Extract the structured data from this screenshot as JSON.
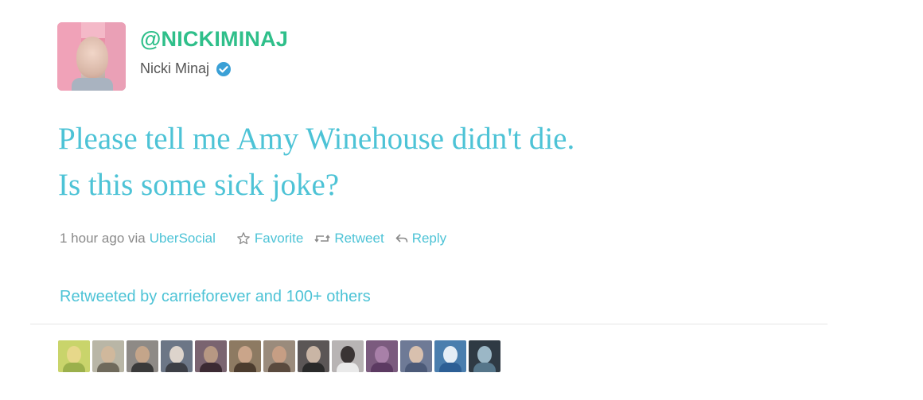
{
  "tweet": {
    "handle": "@NICKIMINAJ",
    "name": "Nicki Minaj",
    "verified": true,
    "text_lines": [
      "Please tell me Amy Winehouse didn't die.",
      "Is this some sick joke?"
    ],
    "time": "1 hour ago via",
    "client": "UberSocial",
    "actions": {
      "favorite": "Favorite",
      "retweet": "Retweet",
      "reply": "Reply"
    }
  },
  "retweets": {
    "label_prefix": "Retweeted by",
    "user": "carrieforever",
    "suffix": "and 100+ others"
  },
  "retweeters": [
    {
      "bg": "#c9d46b",
      "head": "#e7d88a",
      "body": "#9bb04c"
    },
    {
      "bg": "#b9b6a6",
      "head": "#d0b89c",
      "body": "#6f6a5c"
    },
    {
      "bg": "#8e8a86",
      "head": "#c4a58a",
      "body": "#3a3a3a"
    },
    {
      "bg": "#6c7686",
      "head": "#ddd4cc",
      "body": "#3d3f46"
    },
    {
      "bg": "#7a6470",
      "head": "#b79883",
      "body": "#3c2a33"
    },
    {
      "bg": "#8d7a62",
      "head": "#caa58a",
      "body": "#4c3c2e"
    },
    {
      "bg": "#9a8b7c",
      "head": "#c69e84",
      "body": "#5a4a3e"
    },
    {
      "bg": "#5b5656",
      "head": "#c9b5a5",
      "body": "#2a2a2a"
    },
    {
      "bg": "#b8b4b4",
      "head": "#3a3434",
      "body": "#eaeaea"
    },
    {
      "bg": "#7b5b7e",
      "head": "#a880a8",
      "body": "#5c3a62"
    },
    {
      "bg": "#6e7a96",
      "head": "#d8c0ae",
      "body": "#4c5a78"
    },
    {
      "bg": "#4a7eae",
      "head": "#e6eef6",
      "body": "#2d5f95"
    },
    {
      "bg": "#2f3a44",
      "head": "#9bb7c6",
      "body": "#56768a"
    }
  ]
}
